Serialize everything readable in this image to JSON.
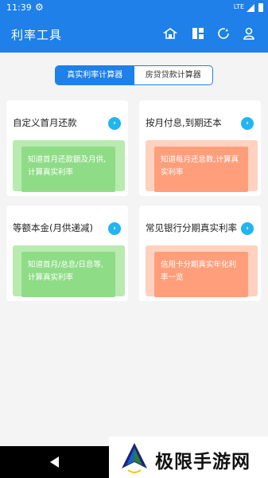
{
  "status_bar": {
    "time": "11:39",
    "network": "LTE"
  },
  "app_bar": {
    "title": "利率工具",
    "icons": [
      "home-icon",
      "grid-icon",
      "refresh-icon",
      "person-icon"
    ]
  },
  "tabs": [
    {
      "label": "真实利率计算器",
      "active": true
    },
    {
      "label": "房贷贷款计算器",
      "active": false
    }
  ],
  "cards": [
    {
      "title": "自定义首月还款",
      "text": "知道首月还款额及月供,计算真实利率",
      "theme": "green"
    },
    {
      "title": "按月付息,到期还本",
      "text": "知道每月还息数,计算真实利率",
      "theme": "orange"
    },
    {
      "title": "等额本金(月供递减)",
      "text": "知道首月/总息/日息等,计算真实利率",
      "theme": "green"
    },
    {
      "title": "常见银行分期真实利率",
      "text": "信用卡分期真实年化利率一览",
      "theme": "orange"
    }
  ],
  "watermark": {
    "text": "极限手游网"
  },
  "colors": {
    "primary": "#1e80e8",
    "arrow": "#21b5f1",
    "green": "#8fdc87",
    "orange": "#ff9e7b"
  }
}
